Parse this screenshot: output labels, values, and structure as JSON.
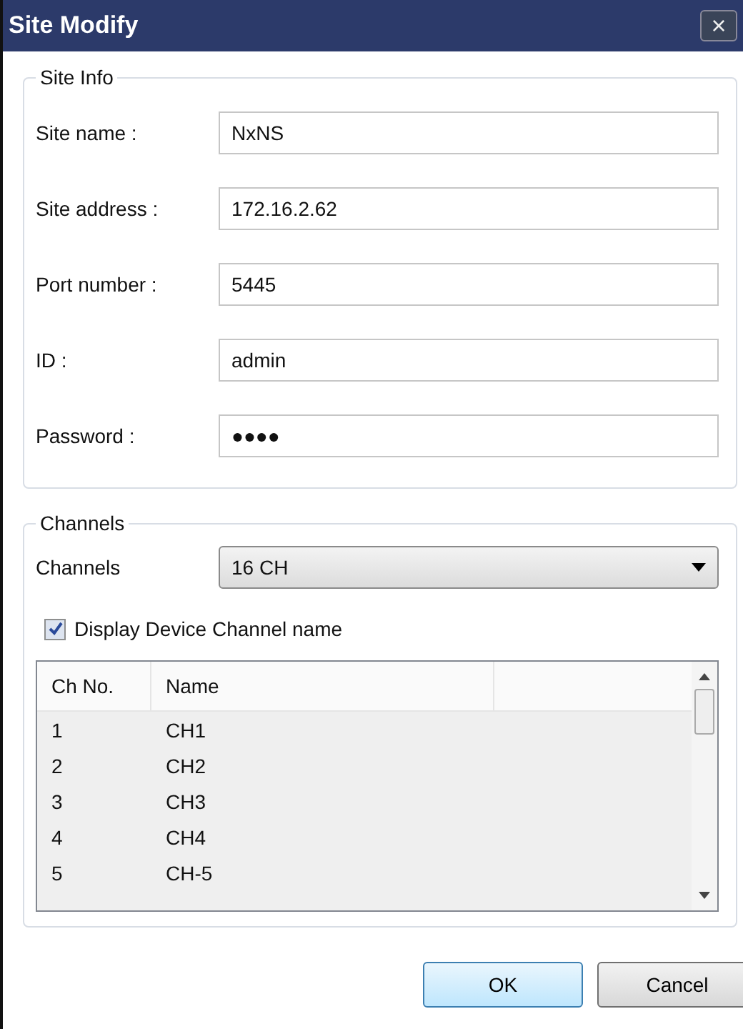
{
  "window": {
    "title": "Site Modify",
    "close": "×"
  },
  "site_info": {
    "legend": "Site Info",
    "fields": [
      {
        "label": "Site name :",
        "value": "NxNS"
      },
      {
        "label": "Site address :",
        "value": "172.16.2.62"
      },
      {
        "label": "Port number :",
        "value": "5445"
      },
      {
        "label": "ID :",
        "value": "admin"
      },
      {
        "label": "Password :",
        "value": "●●●●"
      }
    ]
  },
  "channels": {
    "legend": "Channels",
    "label": "Channels",
    "dropdown": "16 CH",
    "display_name": {
      "label": "Display Device Channel name",
      "checked": true
    },
    "table": {
      "columns": [
        "Ch No.",
        "Name"
      ],
      "rows": [
        {
          "no": "1",
          "name": "CH1"
        },
        {
          "no": "2",
          "name": "CH2"
        },
        {
          "no": "3",
          "name": "CH3"
        },
        {
          "no": "4",
          "name": "CH4"
        },
        {
          "no": "5",
          "name": "CH-5"
        }
      ]
    }
  },
  "buttons": [
    "OK",
    "Cancel"
  ]
}
